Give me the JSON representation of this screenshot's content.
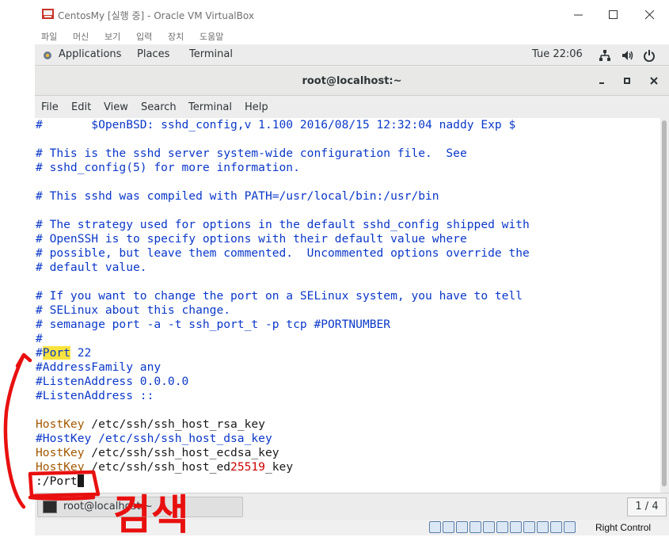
{
  "vbox": {
    "title": "CentosMy [실행 중] - Oracle VM VirtualBox",
    "menu": [
      "파일",
      "머신",
      "보기",
      "입력",
      "장치",
      "도움말"
    ],
    "status_host_key": "Right Control"
  },
  "gnome": {
    "applications": "Applications",
    "places": "Places",
    "terminal": "Terminal",
    "clock": "Tue 22:06"
  },
  "terminal_window": {
    "title": "root@localhost:~",
    "menu": [
      "File",
      "Edit",
      "View",
      "Search",
      "Terminal",
      "Help"
    ]
  },
  "file_lines": {
    "l1": "#       $OpenBSD: sshd_config,v 1.100 2016/08/15 12:32:04 naddy Exp $",
    "l2": "# This is the sshd server system-wide configuration file.  See",
    "l3": "# sshd_config(5) for more information.",
    "l4": "# This sshd was compiled with PATH=/usr/local/bin:/usr/bin",
    "l5": "# The strategy used for options in the default sshd_config shipped with",
    "l6": "# OpenSSH is to specify options with their default value where",
    "l7": "# possible, but leave them commented.  Uncommented options override the",
    "l8": "# default value.",
    "l9": "# If you want to change the port on a SELinux system, you have to tell",
    "l10": "# SELinux about this change.",
    "l11": "# semanage port -a -t ssh_port_t -p tcp #PORTNUMBER",
    "l12": "#",
    "port_hash": "#",
    "port_kw": "Port",
    "port_rest": " 22",
    "l14": "#AddressFamily any",
    "l15": "#ListenAddress 0.0.0.0",
    "l16": "#ListenAddress ::",
    "hk1_kw": "HostKey",
    "hk1_val": " /etc/ssh/ssh_host_rsa_key",
    "hk2": "#HostKey /etc/ssh/ssh_host_dsa_key",
    "hk3_kw": "HostKey",
    "hk3_val": " /etc/ssh/ssh_host_ecdsa_key",
    "hk4_kw": "HostKey",
    "hk4_a": " /etc/ssh/ssh_host_ed",
    "hk4_num": "25519",
    "hk4_b": "_key",
    "command": ":/Port"
  },
  "taskbar": {
    "task_label": "root@localhost:~",
    "pager": "1 / 4"
  },
  "annotation": {
    "handwriting": "검색",
    "color": "#e8100f"
  },
  "colors": {
    "comment": "#0b38c8",
    "keyword": "#a35900",
    "search_highlight": "#fbe33d"
  }
}
